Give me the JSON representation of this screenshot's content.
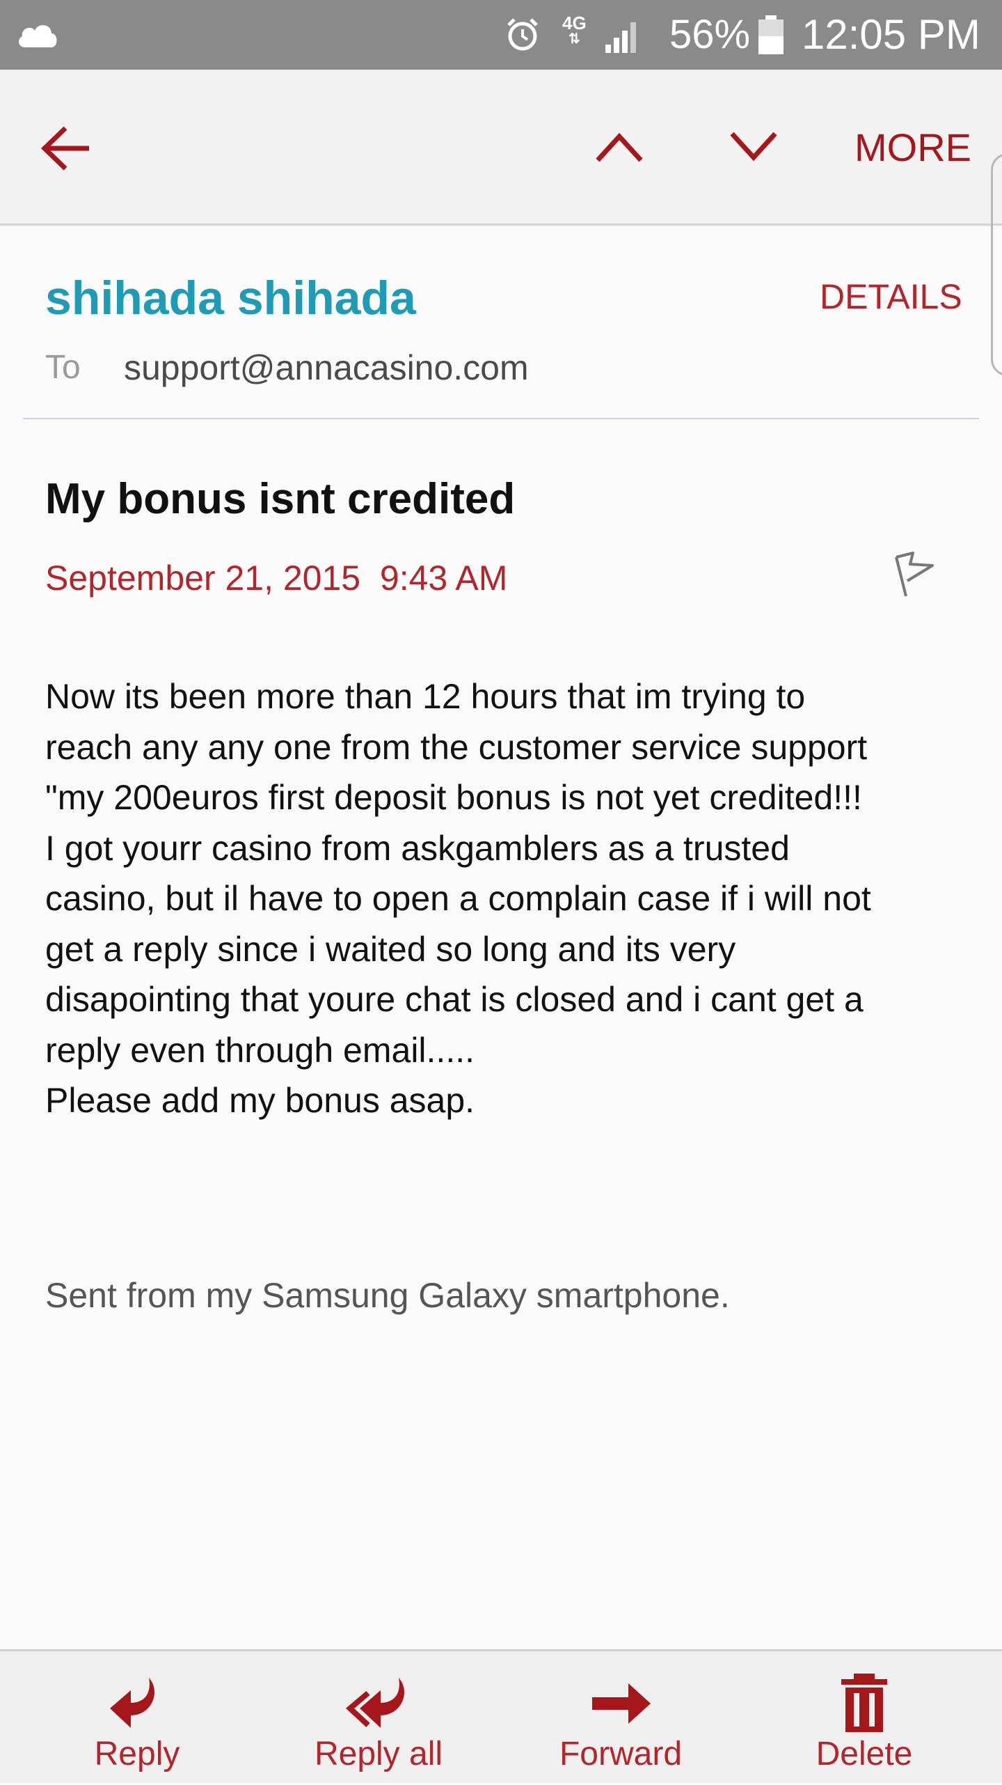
{
  "status_bar": {
    "network": "4G",
    "battery_percent": "56%",
    "time": "12:05 PM"
  },
  "toolbar": {
    "more_label": "MORE"
  },
  "email": {
    "sender": "shihada shihada",
    "details_label": "DETAILS",
    "to_label": "To",
    "to_address": "support@annacasino.com",
    "subject": "My bonus isnt credited",
    "date": "September 21, 2015",
    "time": "9:43 AM",
    "body_lines": [
      "Now its been more than 12 hours that im trying to",
      "reach any any one from the customer service support",
      "\"my 200euros first deposit bonus is not yet credited!!!",
      "I got yourr casino from askgamblers as a trusted",
      "casino, but il have to open a complain case if i will not",
      "get a reply since i waited so long and its very",
      "disapointing that youre chat is closed and i cant get a",
      "reply even through email.....",
      "Please add my bonus asap."
    ],
    "signature": "Sent from my Samsung Galaxy smartphone."
  },
  "actions": {
    "reply": "Reply",
    "reply_all": "Reply all",
    "forward": "Forward",
    "delete": "Delete"
  },
  "colors": {
    "accent": "#b2252a",
    "sender": "#1f9bb5",
    "status_bar": "#8a8a8a"
  }
}
